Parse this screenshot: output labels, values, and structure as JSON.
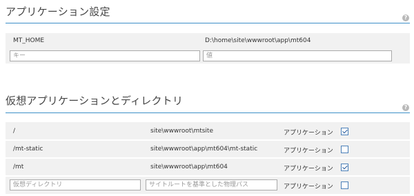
{
  "app_settings": {
    "title": "アプリケーション設定",
    "help": "?",
    "row": {
      "key": "MT_HOME",
      "value": "D:\\home\\site\\wwwroot\\app\\mt604"
    },
    "new_key_placeholder": "キー",
    "new_value_placeholder": "値"
  },
  "virtual_apps": {
    "title": "仮想アプリケーションとディレクトリ",
    "help": "?",
    "rows": [
      {
        "path": "/",
        "physical": "site\\wwwroot\\mtsite",
        "type": "アプリケーション",
        "checked": true
      },
      {
        "path": "/mt-static",
        "physical": "site\\wwwroot\\app\\mt604\\mt-static",
        "type": "アプリケーション",
        "checked": false
      },
      {
        "path": "/mt",
        "physical": "site\\wwwroot\\app\\mt604",
        "type": "アプリケーション",
        "checked": true
      }
    ],
    "new_row": {
      "path_placeholder": "仮想ディレクトリ",
      "physical_placeholder": "サイトルートを基準とした物理パス",
      "type": "アプリケーション",
      "checked": false
    }
  },
  "colors": {
    "accent_rule": "#3c8fc8",
    "panel_bg": "#f1f1f1",
    "checkbox_border": "#4a7fb8"
  }
}
